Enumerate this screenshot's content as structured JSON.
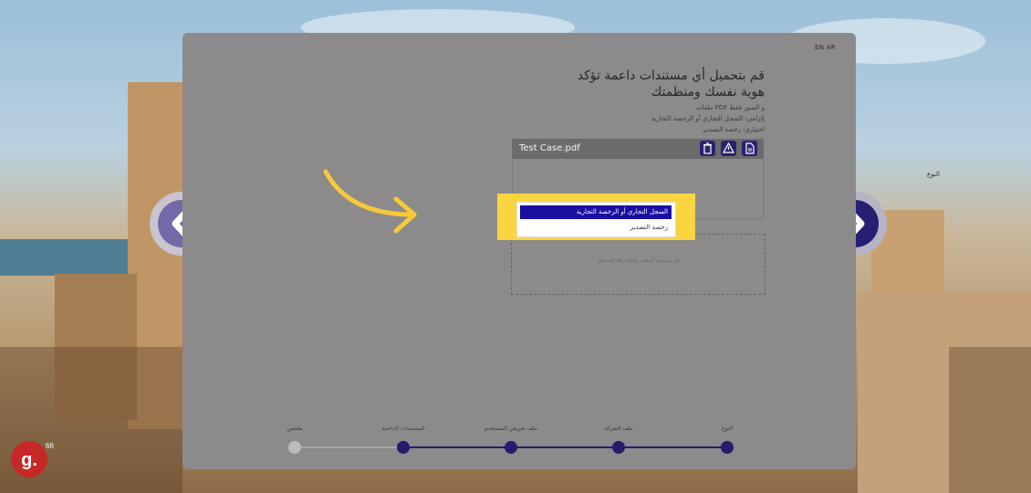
{
  "language_switch": "EN AR",
  "upload": {
    "title_line1": "قم بتحميل أي مستندات داعمة تؤكد",
    "title_line2": "هوية نفسك ومنظمتك",
    "hint_formats": "و الصور فقط PDF ملفات",
    "hint_required": "إلزامي: السجل التجاري أو الرخصة التجارية",
    "hint_optional": "اختياري: رخصة التصدير",
    "file_name": "Test Case.pdf",
    "type_label": "النوع",
    "drop_text": "قم بسحب الملف وإفلاته هنا للتحميل",
    "dropdown_options": [
      "السجل التجاري أو الرخصة التجارية",
      "رخصة التصدير"
    ]
  },
  "steps": [
    {
      "label": "النوع",
      "state": "done"
    },
    {
      "label": "ملف الشركة",
      "state": "done"
    },
    {
      "label": "ملف تعريفي المستخدم",
      "state": "done"
    },
    {
      "label": "المستندات الداعمة",
      "state": "done"
    },
    {
      "label": "ملخص",
      "state": "todo"
    }
  ],
  "icons": {
    "prev": "chevron-left-icon",
    "next": "chevron-right-icon",
    "delete": "trash-icon",
    "warning": "warning-icon",
    "document": "document-icon",
    "tutorial_arrow": "curved-arrow-icon"
  },
  "logo_text": {
    "letter": "g.",
    "superscript": "66"
  },
  "colors": {
    "accent": "#241d6e",
    "highlight": "#fbd540",
    "selected_option": "#1a0fa0"
  }
}
